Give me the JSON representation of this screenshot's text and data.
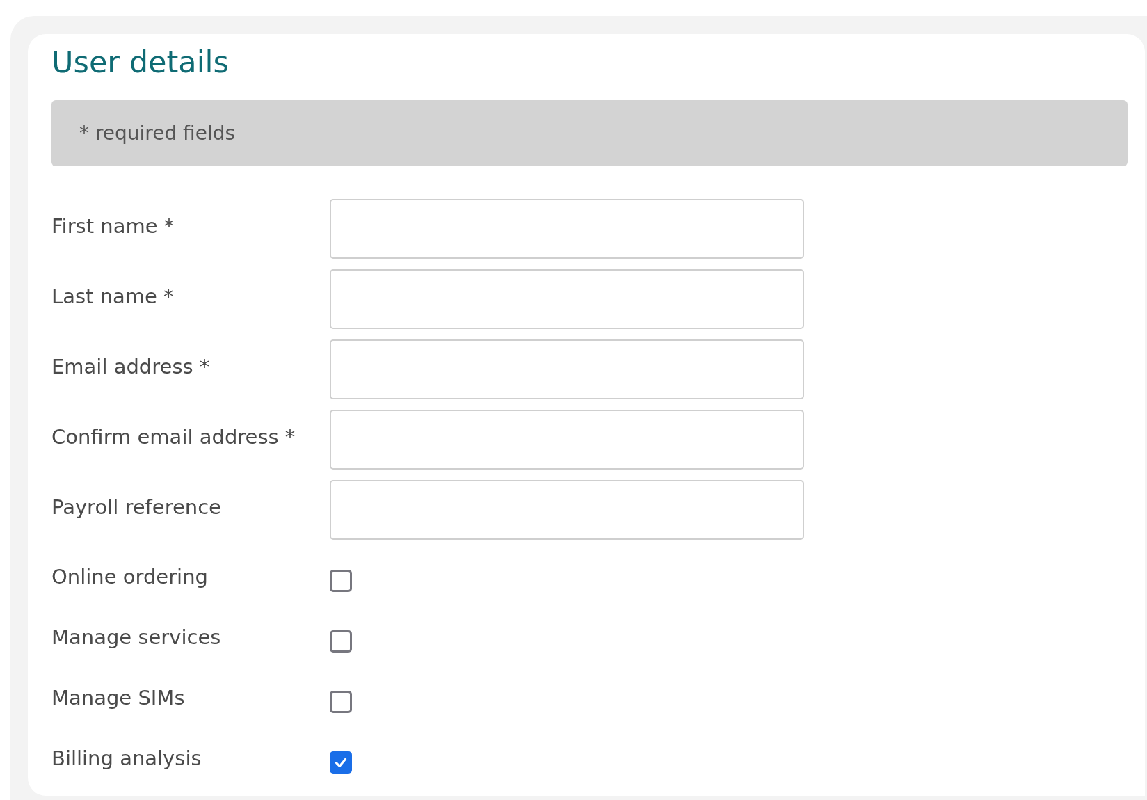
{
  "title": "User details",
  "notice": "* required fields",
  "fields": [
    {
      "kind": "text",
      "label": "First name *"
    },
    {
      "kind": "text",
      "label": "Last name *"
    },
    {
      "kind": "text",
      "label": "Email address *"
    },
    {
      "kind": "text",
      "label": "Confirm email address *"
    },
    {
      "kind": "text",
      "label": "Payroll reference"
    },
    {
      "kind": "checkbox",
      "label": "Online ordering",
      "checked": false
    },
    {
      "kind": "checkbox",
      "label": "Manage services",
      "checked": false
    },
    {
      "kind": "checkbox",
      "label": "Manage SIMs",
      "checked": false
    },
    {
      "kind": "checkbox",
      "label": "Billing analysis",
      "checked": true
    }
  ]
}
